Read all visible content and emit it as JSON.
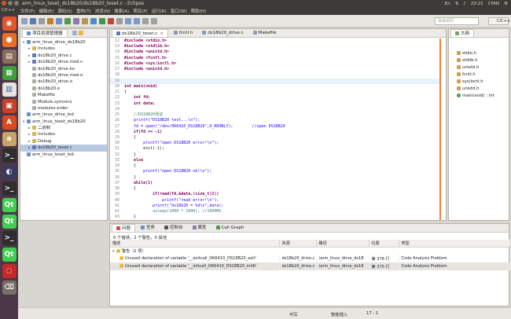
{
  "window": {
    "app_badge": "C/C++",
    "title": "arm_linux_teset_ds18b20/ds18b20_teset.c - Eclipse",
    "tray": {
      "lang": "En",
      "time": "23:21",
      "user": "CFAN"
    }
  },
  "menu": [
    "文件(F)",
    "编辑(E)",
    "源码(S)",
    "重构(T)",
    "浏览(N)",
    "搜索(A)",
    "项目(P)",
    "运行(R)",
    "窗口(W)",
    "帮助(H)"
  ],
  "toolbar": {
    "quick_access_placeholder": "快速访问",
    "perspective_label": "C/C++"
  },
  "explorer": {
    "tab": "项目资源管理器",
    "items": [
      {
        "label": "arm_linux_drive_ds18b20",
        "indent": 0,
        "arrow": "▾",
        "kind": "project"
      },
      {
        "label": "Includes",
        "indent": 1,
        "arrow": "▸",
        "kind": "folder"
      },
      {
        "label": "ds18b20_drive.c",
        "indent": 1,
        "arrow": "▸",
        "kind": "c"
      },
      {
        "label": "ds18b20_drive.mod.c",
        "indent": 1,
        "arrow": "▸",
        "kind": "c"
      },
      {
        "label": "ds18b20_drive.ko",
        "indent": 1,
        "arrow": "",
        "kind": "file"
      },
      {
        "label": "ds18b20_drive.mod.o",
        "indent": 1,
        "arrow": "",
        "kind": "file"
      },
      {
        "label": "ds18b20_drive.o",
        "indent": 1,
        "arrow": "",
        "kind": "file"
      },
      {
        "label": "ds18b20.o",
        "indent": 1,
        "arrow": "",
        "kind": "file"
      },
      {
        "label": "Makefile",
        "indent": 1,
        "arrow": "",
        "kind": "file"
      },
      {
        "label": "Module.symvers",
        "indent": 1,
        "arrow": "",
        "kind": "file"
      },
      {
        "label": "modules.order",
        "indent": 1,
        "arrow": "",
        "kind": "file"
      },
      {
        "label": "arm_linux_drive_led",
        "indent": 0,
        "arrow": "",
        "kind": "project"
      },
      {
        "label": "arm_linux_teset_ds18b20",
        "indent": 0,
        "arrow": "▾",
        "kind": "project"
      },
      {
        "label": "二进制",
        "indent": 1,
        "arrow": "▸",
        "kind": "folder"
      },
      {
        "label": "Includes",
        "indent": 1,
        "arrow": "▸",
        "kind": "folder"
      },
      {
        "label": "Debug",
        "indent": 1,
        "arrow": "▸",
        "kind": "folder"
      },
      {
        "label": "ds18b20_teset.c",
        "indent": 1,
        "arrow": "▸",
        "kind": "c",
        "selected": true
      },
      {
        "label": "arm_linux_teset_led",
        "indent": 0,
        "arrow": "",
        "kind": "project"
      }
    ]
  },
  "editor": {
    "tabs": [
      {
        "label": "ds18b20_teset.c",
        "active": true
      },
      {
        "label": "fcntl.h",
        "active": false
      },
      {
        "label": "ds18b20_drive.c",
        "active": false
      },
      {
        "label": "Makefile",
        "active": false
      }
    ],
    "lines": [
      {
        "n": "12",
        "t": "#include <stdio.h>",
        "c": "pp"
      },
      {
        "n": "13",
        "t": "#include <stdlib.h>",
        "c": "pp"
      },
      {
        "n": "14",
        "t": "#include <unistd.h>",
        "c": "pp"
      },
      {
        "n": "15",
        "t": "#include <fcntl.h>",
        "c": "pp"
      },
      {
        "n": "16",
        "t": "#include <sys/ioctl.h>",
        "c": "pp"
      },
      {
        "n": "17",
        "t": "#include <unistd.h>",
        "c": "pp"
      },
      {
        "n": "18",
        "t": "",
        "c": ""
      },
      {
        "n": "19",
        "t": "",
        "c": "",
        "hl": true
      },
      {
        "n": "20",
        "t": "int main(void)",
        "c": "kw"
      },
      {
        "n": "21",
        "t": "{",
        "c": ""
      },
      {
        "n": "22",
        "t": "    int fd;",
        "c": "kw"
      },
      {
        "n": "23",
        "t": "    int data;",
        "c": "kw"
      },
      {
        "n": "24",
        "t": "",
        "c": ""
      },
      {
        "n": "25",
        "t": "    //DS18B20测试",
        "c": "cm"
      },
      {
        "n": "26",
        "t": "    printf(\"DS18B20 test...\\n\");",
        "c": "str"
      },
      {
        "n": "27",
        "t": "    fd = open(\"/dev/OK6410_DS18B20\",O_RDONLY);        //open DS18B20",
        "c": "str"
      },
      {
        "n": "28",
        "t": "    if(fd == -1)",
        "c": "kw"
      },
      {
        "n": "29",
        "t": "    {",
        "c": ""
      },
      {
        "n": "30",
        "t": "        printf(\"open DS18B20 error!\\n\");",
        "c": "str"
      },
      {
        "n": "31",
        "t": "        exit(-1);",
        "c": ""
      },
      {
        "n": "32",
        "t": "    }",
        "c": ""
      },
      {
        "n": "33",
        "t": "    else",
        "c": "kw"
      },
      {
        "n": "34",
        "t": "    {",
        "c": ""
      },
      {
        "n": "35",
        "t": "        printf(\"open DS18B20 ok!\\n\");",
        "c": "str"
      },
      {
        "n": "36",
        "t": "    }",
        "c": ""
      },
      {
        "n": "37",
        "t": "    while(1)",
        "c": "kw"
      },
      {
        "n": "38",
        "t": "    {",
        "c": ""
      },
      {
        "n": "39",
        "t": "            if(read(fd,&data,(size_t)2))",
        "c": "kw"
      },
      {
        "n": "40",
        "t": "                printf(\"read error!\\n\");",
        "c": "str"
      },
      {
        "n": "41",
        "t": "            printf(\"ds18b20 = %d\\n\",data);",
        "c": "str"
      },
      {
        "n": "42",
        "t": "            usleep(1000 * 1000); //1000MS",
        "c": "cm"
      },
      {
        "n": "43",
        "t": "    }",
        "c": ""
      },
      {
        "n": "44",
        "t": "}",
        "c": ""
      }
    ]
  },
  "outline": {
    "tab": "大纲",
    "items": [
      "stdio.h",
      "stdlib.h",
      "unistd.h",
      "fcntl.h",
      "sys/ioctl.h",
      "unistd.h",
      "main(void) : int"
    ]
  },
  "problems": {
    "tabs": [
      "问题",
      "任务",
      "控制台",
      "属性",
      "Call Graph"
    ],
    "summary": "0 个错误，2 个警告，0 其他",
    "columns": [
      "描述",
      "资源",
      "路径",
      "位置",
      "类型"
    ],
    "group": "警告（2 项）",
    "rows": [
      {
        "desc": "Unused declaration of variable '__exitcall_OK6410_DS18B20_exit'",
        "res": "ds18b20_drive.c",
        "path": "/arm_linux_drive_ds18",
        "loc": "第 376 行",
        "type": "Code Analysis Problem"
      },
      {
        "desc": "Unused declaration of variable '__initcall_OK6410_DS18B20_init6'",
        "res": "ds18b20_drive.c",
        "path": "/arm_linux_drive_ds18",
        "loc": "第 375 行",
        "type": "Code Analysis Problem"
      }
    ]
  },
  "status": {
    "writable": "可写",
    "insert": "智能插入",
    "pos": "17 : 1"
  }
}
